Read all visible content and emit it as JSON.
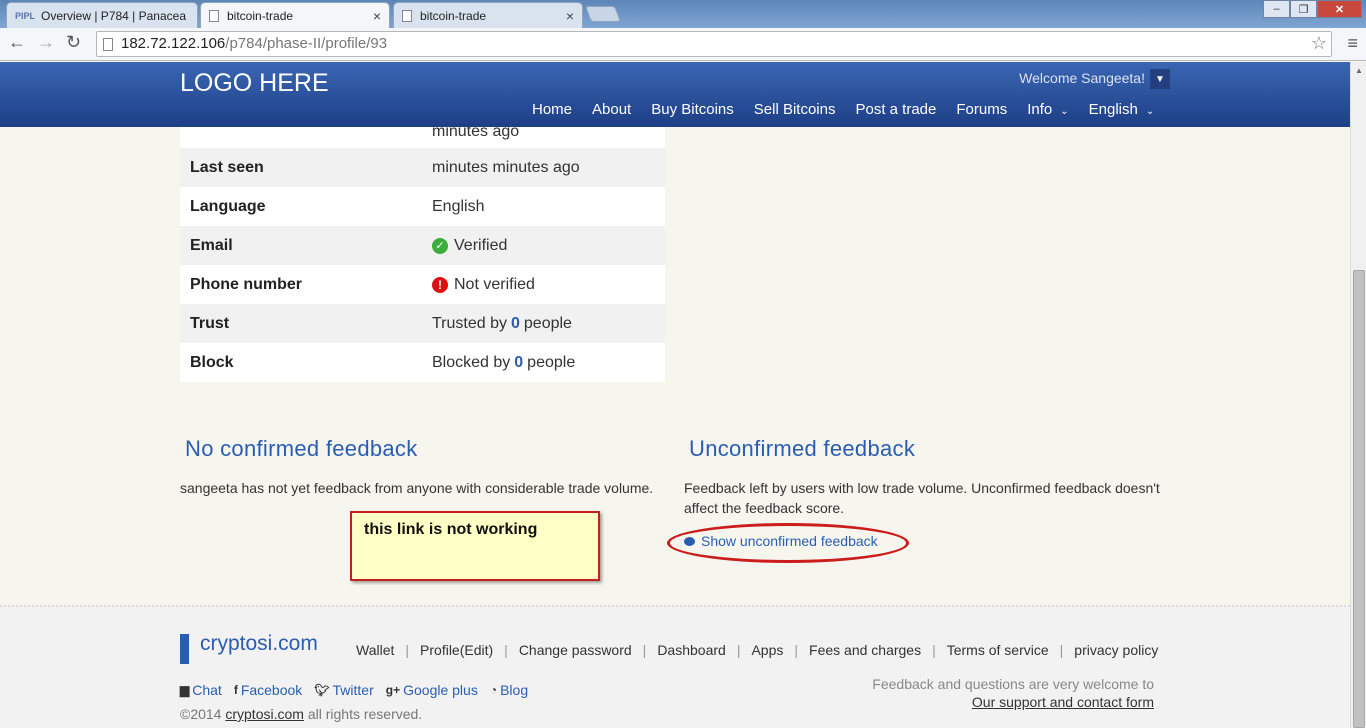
{
  "browser": {
    "tabs": [
      {
        "favicon": "PIPL",
        "title": "Overview | P784 | Panacea"
      },
      {
        "title": "bitcoin-trade"
      },
      {
        "title": "bitcoin-trade"
      }
    ],
    "url": {
      "host": "182.72.122.106",
      "path": "/p784/phase-II/profile/93"
    }
  },
  "header": {
    "logo": "LOGO HERE",
    "welcome": "Welcome Sangeeta!",
    "nav": [
      "Home",
      "About",
      "Buy Bitcoins",
      "Sell Bitcoins",
      "Post a trade",
      "Forums",
      "Info",
      "English"
    ]
  },
  "profile": {
    "partial_value": "minutes ago",
    "rows": [
      {
        "label": "Last seen",
        "value": "minutes minutes ago"
      },
      {
        "label": "Language",
        "value": "English"
      },
      {
        "label": "Email",
        "value": "Verified"
      },
      {
        "label": "Phone number",
        "value": "Not verified"
      },
      {
        "label": "Trust",
        "prefix": "Trusted by",
        "count": "0",
        "suffix": "people"
      },
      {
        "label": "Block",
        "prefix": "Blocked by",
        "count": "0",
        "suffix": "people"
      }
    ]
  },
  "feedback": {
    "confirmed_title": "No confirmed feedback",
    "confirmed_text": "sangeeta has not yet feedback from anyone with considerable trade volume.",
    "unconfirmed_title": "Unconfirmed feedback",
    "unconfirmed_text": "Feedback left by users with low trade volume. Unconfirmed feedback doesn't affect the feedback score.",
    "show_link": "Show unconfirmed feedback",
    "annotation_note": "this link is not working"
  },
  "footer": {
    "brand": "cryptosi.com",
    "links": [
      "Wallet",
      "Profile(Edit)",
      "Change password",
      "Dashboard",
      "Apps",
      "Fees and charges",
      "Terms of service",
      "privacy policy"
    ],
    "social": [
      "Chat",
      "Facebook",
      "Twitter",
      "Google plus",
      "Blog"
    ],
    "copyright_year": "©2014",
    "copyright_link": "cryptosi.com",
    "copyright_suffix": "all rights reserved.",
    "feedback_welcome": "Feedback and questions are very welcome to",
    "support_link": "Our support and contact form"
  },
  "colors": {
    "accent": "#2a5db0",
    "header_top": "#3b66b3",
    "header_bottom": "#1d3f86",
    "annotation_red": "#cc1c1c"
  }
}
